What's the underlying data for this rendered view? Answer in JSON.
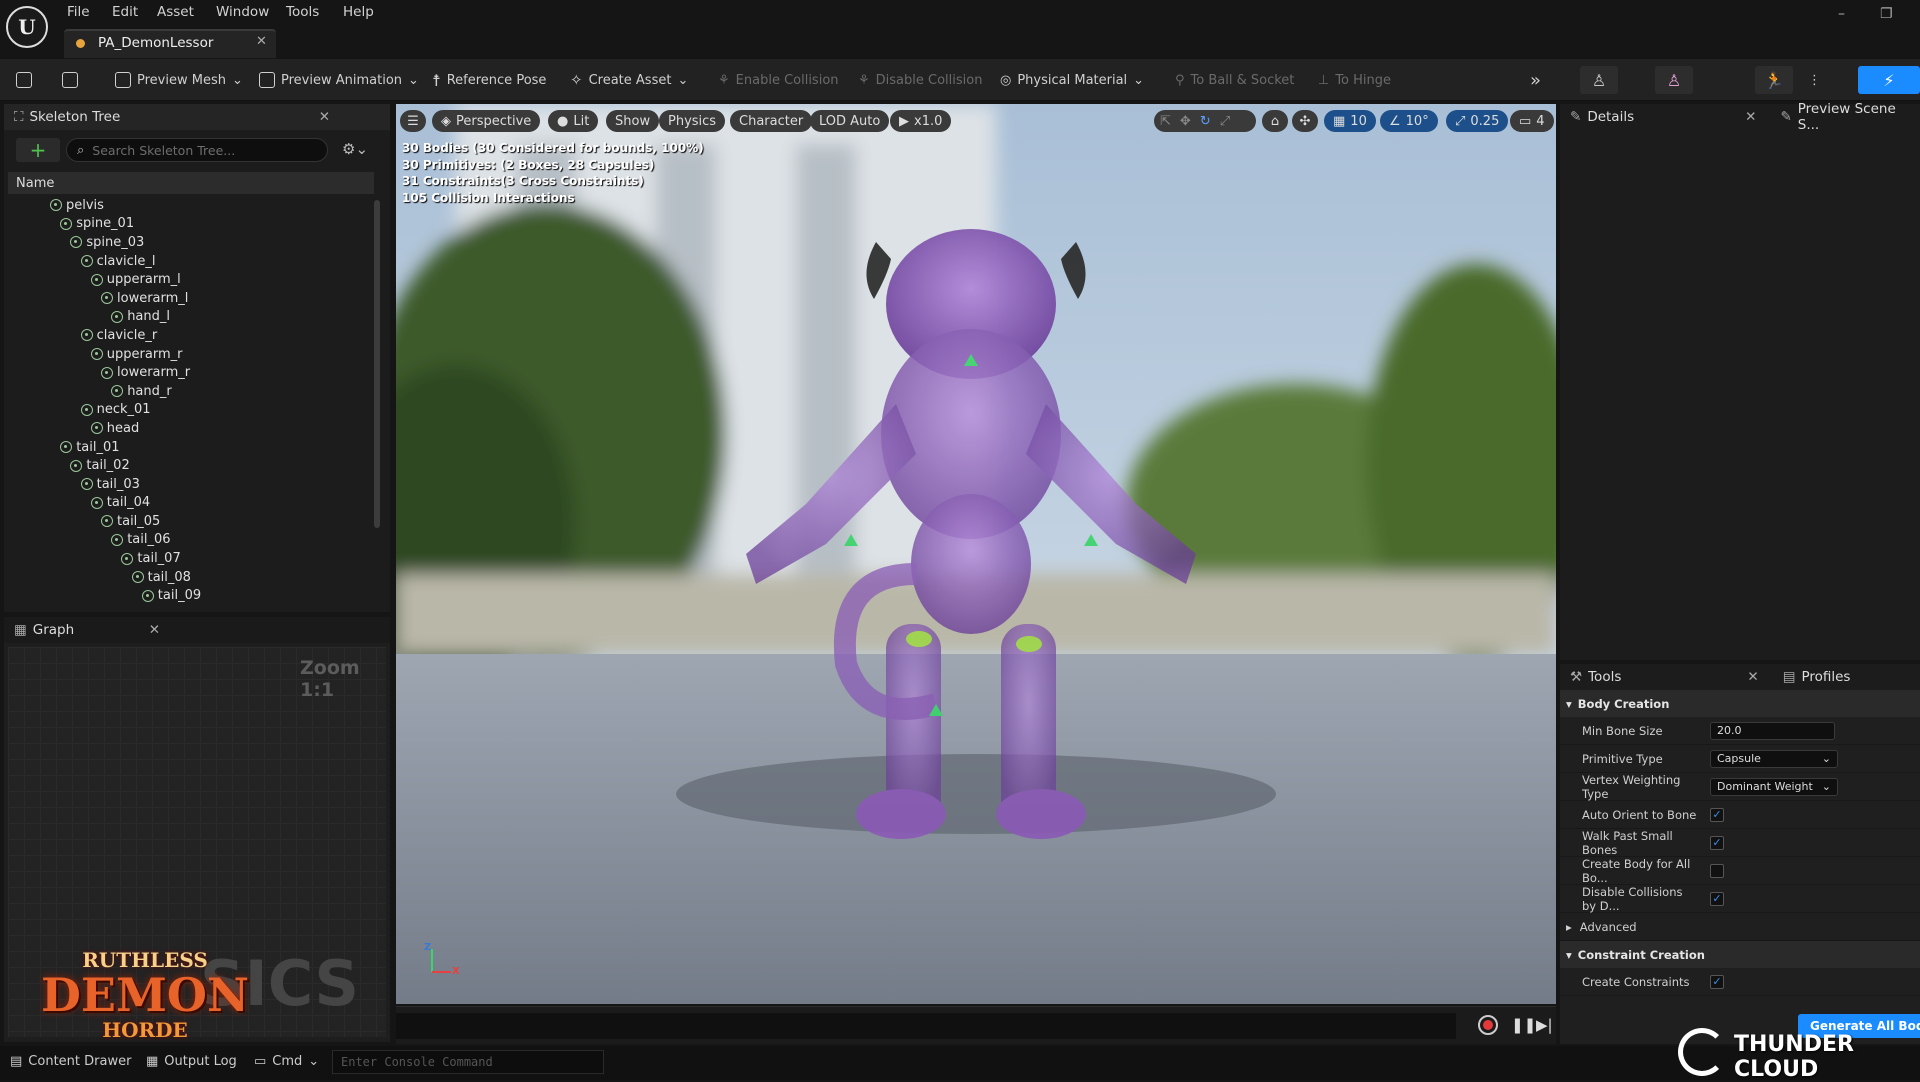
{
  "menu": {
    "items": [
      "File",
      "Edit",
      "Asset",
      "Window",
      "Tools",
      "Help"
    ]
  },
  "tab": {
    "title": "PA_DemonLessor"
  },
  "toolbar": {
    "preview_mesh": "Preview Mesh",
    "preview_animation": "Preview Animation",
    "reference_pose": "Reference Pose",
    "create_asset": "Create Asset",
    "enable_collision": "Enable Collision",
    "disable_collision": "Disable Collision",
    "physical_material": "Physical Material",
    "to_ball_socket": "To Ball & Socket",
    "to_hinge": "To Hinge"
  },
  "skeleton_tree": {
    "title": "Skeleton Tree",
    "search_placeholder": "Search Skeleton Tree...",
    "column_name": "Name",
    "bones": [
      {
        "name": "pelvis",
        "depth": 0
      },
      {
        "name": "spine_01",
        "depth": 1
      },
      {
        "name": "spine_03",
        "depth": 2
      },
      {
        "name": "clavicle_l",
        "depth": 3
      },
      {
        "name": "upperarm_l",
        "depth": 4
      },
      {
        "name": "lowerarm_l",
        "depth": 5
      },
      {
        "name": "hand_l",
        "depth": 6
      },
      {
        "name": "clavicle_r",
        "depth": 3
      },
      {
        "name": "upperarm_r",
        "depth": 4
      },
      {
        "name": "lowerarm_r",
        "depth": 5
      },
      {
        "name": "hand_r",
        "depth": 6
      },
      {
        "name": "neck_01",
        "depth": 3
      },
      {
        "name": "head",
        "depth": 4
      },
      {
        "name": "tail_01",
        "depth": 1
      },
      {
        "name": "tail_02",
        "depth": 2
      },
      {
        "name": "tail_03",
        "depth": 3
      },
      {
        "name": "tail_04",
        "depth": 4
      },
      {
        "name": "tail_05",
        "depth": 5
      },
      {
        "name": "tail_06",
        "depth": 6
      },
      {
        "name": "tail_07",
        "depth": 7
      },
      {
        "name": "tail_08",
        "depth": 8
      },
      {
        "name": "tail_09",
        "depth": 9
      }
    ]
  },
  "graph": {
    "title": "Graph",
    "zoom": "Zoom 1:1",
    "watermark": "SICS"
  },
  "viewport": {
    "perspective": "Perspective",
    "lit": "Lit",
    "show": "Show",
    "physics": "Physics",
    "character": "Character",
    "lod": "LOD Auto",
    "speed": "x1.0",
    "grid_snap": "10",
    "rot_snap": "10°",
    "scale_snap": "0.25",
    "camera_speed": "4",
    "stats": [
      "30 Bodies (30 Considered for bounds, 100%)",
      "30 Primitives: (2 Boxes, 28 Capsules)",
      "31 Constraints(3 Cross Constraints)",
      "105 Collision Interactions"
    ],
    "axis_z": "Z",
    "axis_x": "X"
  },
  "details": {
    "tab": "Details",
    "preview_scene_tab": "Preview Scene S..."
  },
  "tools": {
    "tab": "Tools",
    "profiles_tab": "Profiles",
    "body_creation": "Body Creation",
    "min_bone_size_label": "Min Bone Size",
    "min_bone_size": "20.0",
    "primitive_type_label": "Primitive Type",
    "primitive_type": "Capsule",
    "vertex_weighting_label": "Vertex Weighting Type",
    "vertex_weighting": "Dominant Weight",
    "auto_orient_label": "Auto Orient to Bone",
    "walk_past_label": "Walk Past Small Bones",
    "create_body_all_label": "Create Body for All Bo...",
    "disable_collisions_label": "Disable Collisions by D...",
    "advanced": "Advanced",
    "constraint_creation": "Constraint Creation",
    "create_constraints_label": "Create Constraints",
    "generate_button": "Generate All Bodie"
  },
  "bottombar": {
    "content_drawer": "Content Drawer",
    "output_log": "Output Log",
    "cmd": "Cmd",
    "console_placeholder": "Enter Console Command"
  },
  "overlay": {
    "game_logo_top": "RUTHLESS",
    "game_logo_mid": "DEMON",
    "game_logo_bottom": "HORDE",
    "brand": "THUNDER CLOUD"
  },
  "colors": {
    "accent": "#1a8cff",
    "checkbox": "#3b8ee8",
    "demon": "#8a5ac0"
  }
}
